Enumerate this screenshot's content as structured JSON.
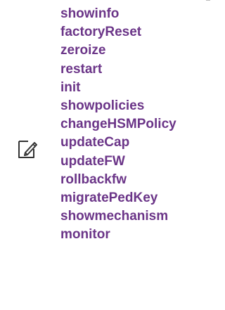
{
  "note": {
    "icon": "note-pencil-icon",
    "icon_color": "#333333"
  },
  "commands": {
    "color": "#6b3588",
    "items": [
      "showinfo",
      "factoryReset",
      "zeroize",
      "restart",
      "init",
      "showpolicies",
      "changeHSMPolicy",
      "updateCap",
      "updateFW",
      "rollbackfw",
      "migratePedKey",
      "showmechanism",
      "monitor"
    ]
  }
}
